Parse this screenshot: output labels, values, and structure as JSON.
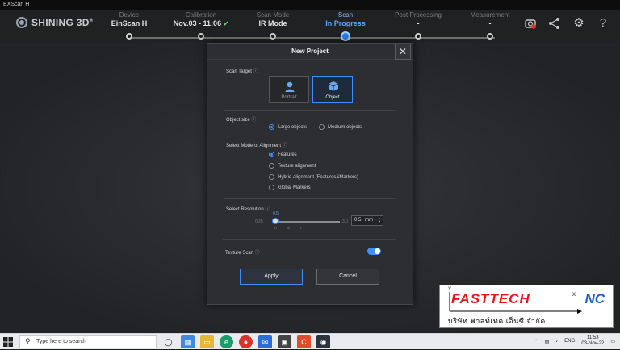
{
  "window": {
    "title": "EXScan H"
  },
  "brand": {
    "logo_text": "SHINING 3D",
    "registered": "®"
  },
  "steps": [
    {
      "label": "Device",
      "value": "EinScan H",
      "state": "done"
    },
    {
      "label": "Calibration",
      "value": "Nov.03 - 11:06",
      "state": "done",
      "check": "✔"
    },
    {
      "label": "Scan Mode",
      "value": "IR Mode",
      "state": "done"
    },
    {
      "label": "Scan",
      "value": "In Progress",
      "state": "active"
    },
    {
      "label": "Post Processing",
      "value": "-",
      "state": "pending"
    },
    {
      "label": "Measurement",
      "value": "-",
      "state": "pending"
    }
  ],
  "tools": {
    "scanner": "scanner-icon",
    "share": "share-icon",
    "settings": "gear-icon",
    "help": "help-icon"
  },
  "dialog": {
    "title": "New Project",
    "close": "✕",
    "scan_target": {
      "label": "Scan Target",
      "options": [
        {
          "label": "Portrait",
          "selected": false
        },
        {
          "label": "Object",
          "selected": true
        }
      ]
    },
    "object_size": {
      "label": "Object size",
      "options": [
        {
          "label": "Large objects",
          "selected": true
        },
        {
          "label": "Medium objects",
          "selected": false
        }
      ]
    },
    "alignment": {
      "label": "Select Mode of Alignment",
      "options": [
        {
          "label": "Features",
          "selected": true
        },
        {
          "label": "Texture alignment",
          "selected": false
        },
        {
          "label": "Hybrid alignment (Features&Markers)",
          "selected": false
        },
        {
          "label": "Global Markers",
          "selected": false
        }
      ]
    },
    "resolution": {
      "label": "Select Resolution",
      "min": "0.25",
      "max": "3.0",
      "current": "0.5",
      "value": "0.5",
      "unit": "mm",
      "ticks": [
        "H",
        "M",
        "L"
      ]
    },
    "texture_scan": {
      "label": "Texture Scan",
      "enabled": true
    },
    "apply_label": "Apply",
    "cancel_label": "Cancel"
  },
  "watermark": {
    "main": "FASTTECH",
    "nc": "NC",
    "thai": "บริษัท ฟาสท์เทค เอ็นซี จำกัด",
    "axis_y": "Y",
    "axis_x": "X"
  },
  "taskbar": {
    "search_placeholder": "Type here to search",
    "language": "ENG",
    "time": "11:53",
    "date": "03-Nov-22"
  },
  "colors": {
    "accent": "#3d8fff",
    "active_step": "#5aa9ff",
    "check": "#5fd06a",
    "brand_red": "#e8141b",
    "brand_blue": "#1663c7"
  }
}
